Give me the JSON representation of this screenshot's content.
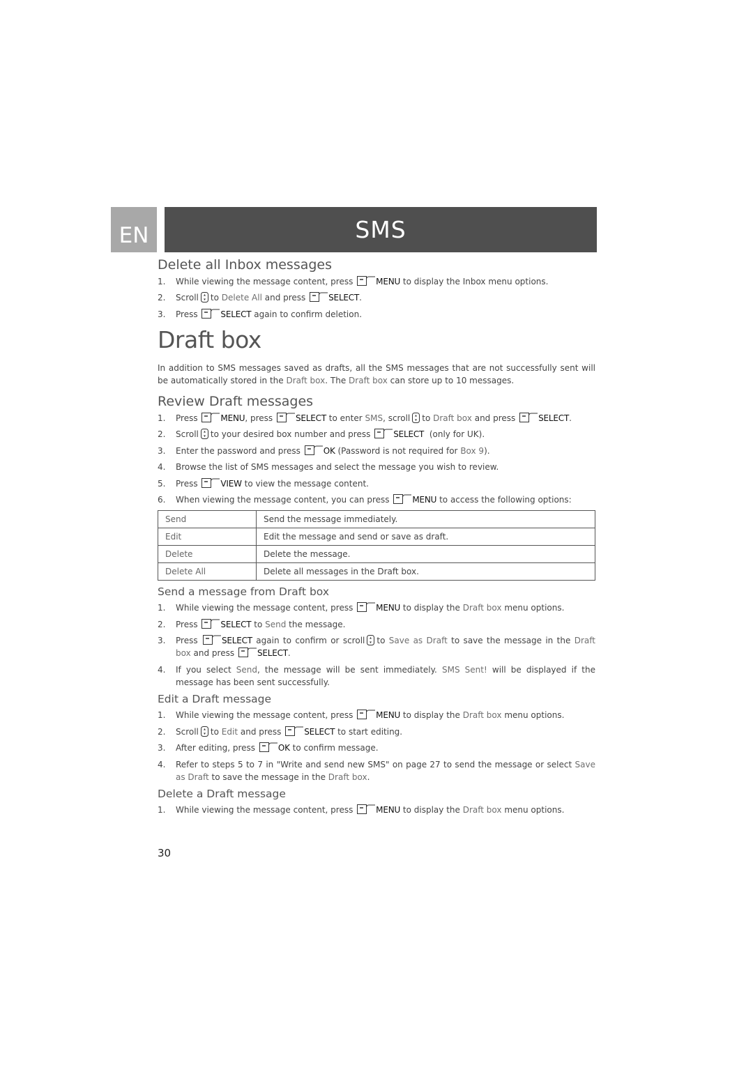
{
  "header": {
    "lang_tab": "EN",
    "section_title": "SMS"
  },
  "inbox": {
    "title": "Delete all Inbox messages",
    "steps": [
      {
        "n": "1.",
        "a": "While viewing the message content, press",
        "k": "MENU",
        "b": "to display the Inbox menu options."
      },
      {
        "n": "2.",
        "a": "Scroll",
        "c": "to",
        "h": "Delete All",
        "d": "and press",
        "k": "SELECT",
        "e": "."
      },
      {
        "n": "3.",
        "a": "Press",
        "k": "SELECT",
        "b": "again to confirm deletion."
      }
    ]
  },
  "draft": {
    "title": "Draft box",
    "intro_a": "In addition to SMS messages saved as drafts, all the SMS messages that are not successfully sent will be automatically stored in the",
    "intro_h1": "Draft box",
    "intro_b": ". The",
    "intro_h2": "Draft box",
    "intro_c": "can store up to 10 messages."
  },
  "review": {
    "title": "Review Draft messages",
    "s1": {
      "n": "1.",
      "a": "Press",
      "k1": "MENU",
      "b": ", press",
      "k2": "SELECT",
      "c": "to enter",
      "h1": "SMS",
      "d": ", scroll",
      "e": "to",
      "h2": "Draft box",
      "f": "and press",
      "k3": "SELECT",
      "g": "."
    },
    "s2": {
      "n": "2.",
      "a": "Scroll",
      "b": "to your desired box number and press",
      "k": "SELECT",
      "c": "(only for UK)."
    },
    "s3": {
      "n": "3.",
      "a": "Enter the password and press",
      "k": "OK",
      "b": "(Password is not required for",
      "h": "Box 9",
      "c": ")."
    },
    "s4": {
      "n": "4.",
      "a": "Browse the list of SMS messages and select the message you wish to review."
    },
    "s5": {
      "n": "5.",
      "a": "Press",
      "k": "VIEW",
      "b": "to view the message content."
    },
    "s6": {
      "n": "6.",
      "a": "When viewing the message content, you can press",
      "k": "MENU",
      "b": "to access the following options:"
    }
  },
  "options_table": [
    {
      "option": "Send",
      "description": "Send the message immediately."
    },
    {
      "option": "Edit",
      "description": "Edit the message and send or save as draft."
    },
    {
      "option": "Delete",
      "description": "Delete the message."
    },
    {
      "option": "Delete All",
      "description": "Delete all messages in the Draft box."
    }
  ],
  "send_from_draft": {
    "title": "Send a message from Draft box",
    "s1": {
      "n": "1.",
      "a": "While viewing the message content, press",
      "k": "MENU",
      "b": "to display the",
      "h": "Draft box",
      "c": "menu options."
    },
    "s2": {
      "n": "2.",
      "a": "Press",
      "k": "SELECT",
      "b": "to",
      "h": "Send",
      "c": "the message."
    },
    "s3": {
      "n": "3.",
      "a": "Press",
      "k": "SELECT",
      "b": "again to confirm or scroll",
      "c": "to",
      "h1": "Save as Draft",
      "d": "to save the message in the",
      "h2": "Draft box",
      "e": "and press",
      "k2": "SELECT",
      "f": "."
    },
    "s4": {
      "n": "4.",
      "a": "If you select",
      "h1": "Send",
      "b": ", the message will be sent immediately.",
      "h2": "SMS Sent!",
      "c": "will be displayed if the message has been sent successfully."
    }
  },
  "edit_draft": {
    "title": "Edit a Draft message",
    "s1": {
      "n": "1.",
      "a": "While viewing the message content, press",
      "k": "MENU",
      "b": "to display the",
      "h": "Draft box",
      "c": "menu options."
    },
    "s2": {
      "n": "2.",
      "a": "Scroll",
      "b": "to",
      "h": "Edit",
      "c": "and press",
      "k": "SELECT",
      "d": "to start editing."
    },
    "s3": {
      "n": "3.",
      "a": "After editing, press",
      "k": "OK",
      "b": "to confirm message."
    },
    "s4": {
      "n": "4.",
      "a": "Refer to steps 5 to 7 in \"Write and send new SMS\" on page 27 to send the message or select",
      "h1": "Save as Draft",
      "b": "to save the message in the",
      "h2": "Draft box",
      "c": "."
    }
  },
  "delete_draft": {
    "title": "Delete a Draft message",
    "s1": {
      "n": "1.",
      "a": "While viewing the message content, press",
      "k": "MENU",
      "b": "to display the",
      "h": "Draft box",
      "c": "menu options."
    }
  },
  "page_number": "30",
  "icons": {
    "softkey": "left-softkey-icon",
    "nav": "navigation-key-icon"
  }
}
